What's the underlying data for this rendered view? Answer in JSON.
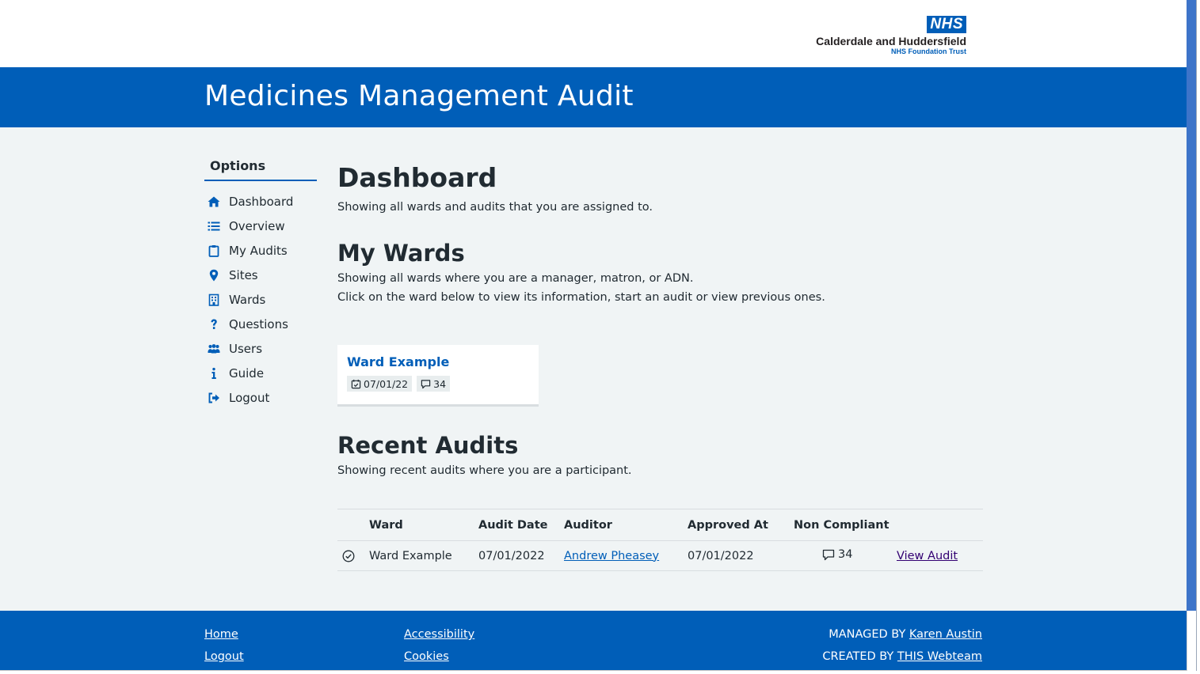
{
  "header": {
    "nhs_logo_text": "NHS",
    "trust_name": "Calderdale and Huddersfield",
    "trust_sub": "NHS Foundation Trust",
    "app_title": "Medicines Management Audit"
  },
  "sidebar": {
    "heading": "Options",
    "items": [
      {
        "label": "Dashboard",
        "icon": "home-icon"
      },
      {
        "label": "Overview",
        "icon": "list-icon"
      },
      {
        "label": "My Audits",
        "icon": "clipboard-icon"
      },
      {
        "label": "Sites",
        "icon": "map-pin-icon"
      },
      {
        "label": "Wards",
        "icon": "building-icon"
      },
      {
        "label": "Questions",
        "icon": "question-icon"
      },
      {
        "label": "Users",
        "icon": "users-icon"
      },
      {
        "label": "Guide",
        "icon": "info-icon"
      },
      {
        "label": "Logout",
        "icon": "logout-icon"
      }
    ]
  },
  "main": {
    "title": "Dashboard",
    "subtitle": "Showing all wards and audits that you are assigned to.",
    "my_wards": {
      "title": "My Wards",
      "desc1": "Showing all wards where you are a manager, matron, or ADN.",
      "desc2": "Click on the ward below to view its information, start an audit or view previous ones.",
      "card": {
        "name": "Ward Example",
        "date": "07/01/22",
        "comments": "34"
      }
    },
    "recent_audits": {
      "title": "Recent Audits",
      "desc": "Showing recent audits where you are a participant.",
      "columns": [
        "Ward",
        "Audit Date",
        "Auditor",
        "Approved At",
        "Non Compliant"
      ],
      "rows": [
        {
          "ward": "Ward Example",
          "audit_date": "07/01/2022",
          "auditor": "Andrew Pheasey",
          "approved_at": "07/01/2022",
          "non_compliant": "34",
          "action": "View Audit"
        }
      ]
    }
  },
  "footer": {
    "home": "Home",
    "logout": "Logout",
    "accessibility": "Accessibility",
    "cookies": "Cookies",
    "managed_prefix": "MANAGED BY",
    "managed_name": "Karen Austin",
    "created_prefix": "CREATED BY",
    "created_name": "THIS Webteam"
  },
  "colors": {
    "brand_blue": "#005eb8",
    "background": "#f0f4f5",
    "text": "#212b32",
    "visited": "#330072"
  }
}
